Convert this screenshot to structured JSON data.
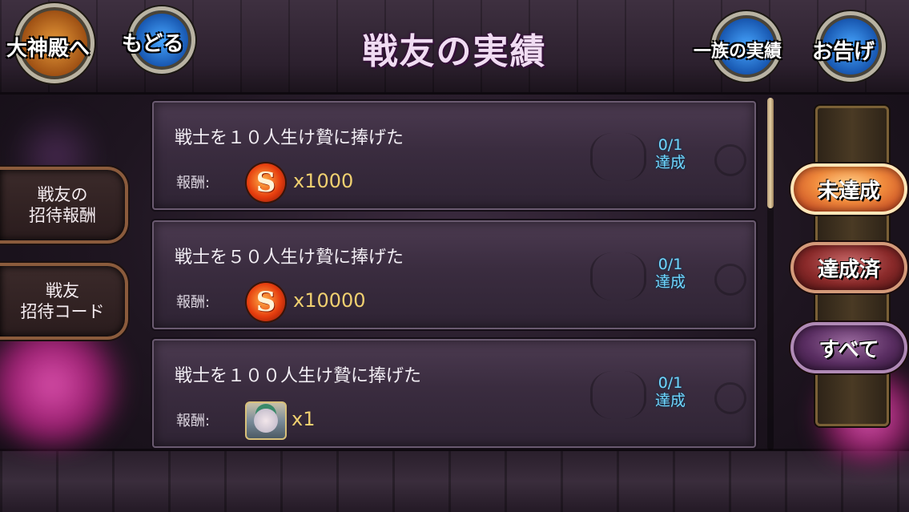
{
  "header": {
    "title": "戦友の実績",
    "back_to_temple_label": "大神殿へ",
    "back_label": "もどる",
    "clan_achievements_label": "一族の実績",
    "notice_label": "お告げ"
  },
  "sidebar": {
    "invite_reward_label": "戦友の\n招待報酬",
    "invite_code_label": "戦友\n招待コード"
  },
  "achievements": [
    {
      "title": "戦士を１０人生け贄に捧げた",
      "reward_label": "報酬:",
      "reward_icon": "coin-icon",
      "reward_amount": "x1000",
      "progress": "0/1",
      "status": "達成"
    },
    {
      "title": "戦士を５０人生け贄に捧げた",
      "reward_label": "報酬:",
      "reward_icon": "coin-icon",
      "reward_amount": "x10000",
      "progress": "0/1",
      "status": "達成"
    },
    {
      "title": "戦士を１００人生け贄に捧げた",
      "reward_label": "報酬:",
      "reward_icon": "character-card-icon",
      "reward_amount": "x1",
      "progress": "0/1",
      "status": "達成"
    }
  ],
  "filters": {
    "incomplete_label": "未達成",
    "completed_label": "達成済",
    "all_label": "すべて",
    "active": "未達成"
  },
  "colors": {
    "progress_text": "#6fd6ff",
    "reward_amount": "#f0d070",
    "title_text": "#f0dcf2"
  }
}
